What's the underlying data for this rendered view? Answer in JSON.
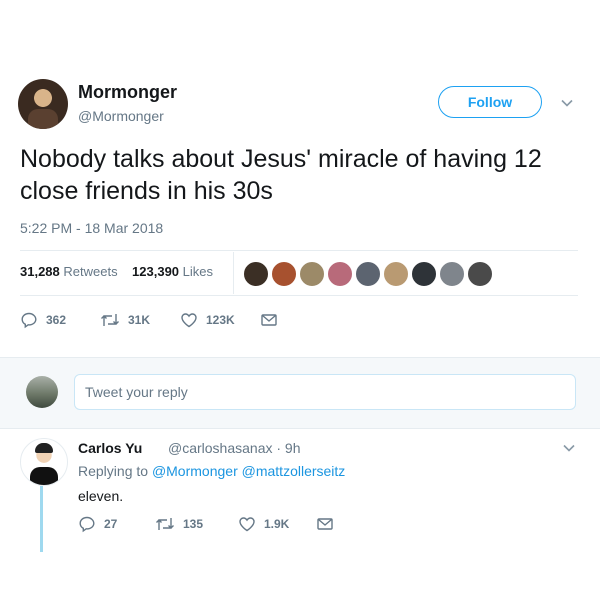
{
  "tweet": {
    "author_name": "Mormonger",
    "author_handle": "@Mormonger",
    "follow_label": "Follow",
    "text": "Nobody talks about Jesus' miracle of having 12 close friends in his 30s",
    "timestamp": "5:22 PM - 18 Mar 2018",
    "retweets_count": "31,288",
    "retweets_label": "Retweets",
    "likes_count": "123,390",
    "likes_label": "Likes",
    "actions": {
      "replies": "362",
      "retweets": "31K",
      "likes": "123K"
    }
  },
  "reply_box": {
    "placeholder": "Tweet your reply"
  },
  "reply": {
    "author_name": "Carlos Yu",
    "meta": "@carloshasanax · 9h",
    "replying_prefix": "Replying to",
    "replying_to_1": "@Mormonger",
    "replying_to_2": "@mattzollerseitz",
    "text": "eleven.",
    "actions": {
      "replies": "27",
      "retweets": "135",
      "likes": "1.9K"
    }
  },
  "colors": {
    "accent": "#1da1f2",
    "link": "#1b95e0",
    "muted": "#657786",
    "divider": "#e6ecf0",
    "thread_line": "#9fd9ef"
  },
  "icons": [
    "chevron-down-icon",
    "reply-icon",
    "retweet-icon",
    "like-icon",
    "message-icon"
  ]
}
